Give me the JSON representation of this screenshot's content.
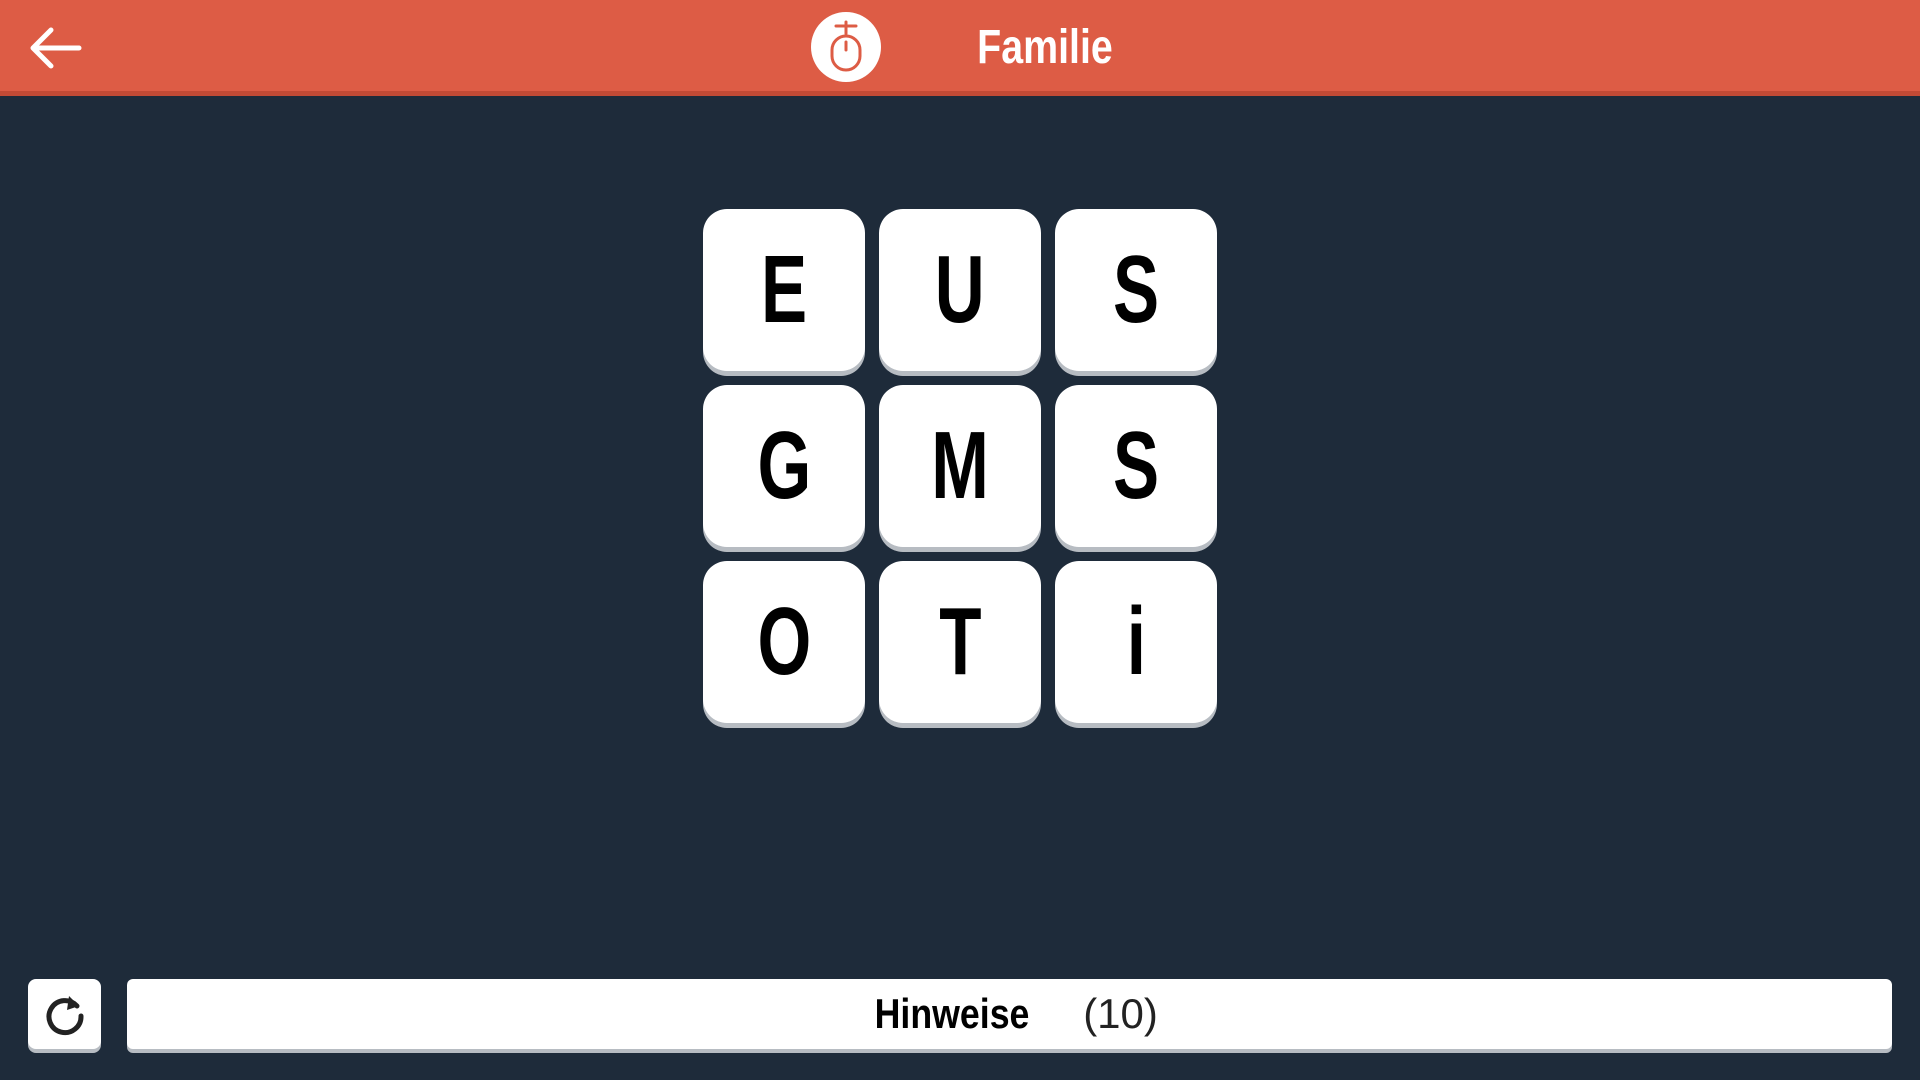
{
  "header": {
    "title": "Familie",
    "back_icon": "arrow-left-icon",
    "badge_icon": "mouse-icon",
    "background_color": "#dd5c45"
  },
  "grid": {
    "tiles": [
      {
        "letter": "E"
      },
      {
        "letter": "U"
      },
      {
        "letter": "S"
      },
      {
        "letter": "G"
      },
      {
        "letter": "M"
      },
      {
        "letter": "S"
      },
      {
        "letter": "O"
      },
      {
        "letter": "T"
      },
      {
        "letter": "i"
      }
    ]
  },
  "footer": {
    "restart_icon": "restart-icon",
    "hints_label": "Hinweise",
    "hints_count": "(10)"
  },
  "colors": {
    "background": "#1e2b3a",
    "tile": "#ffffff",
    "accent": "#dd5c45"
  }
}
